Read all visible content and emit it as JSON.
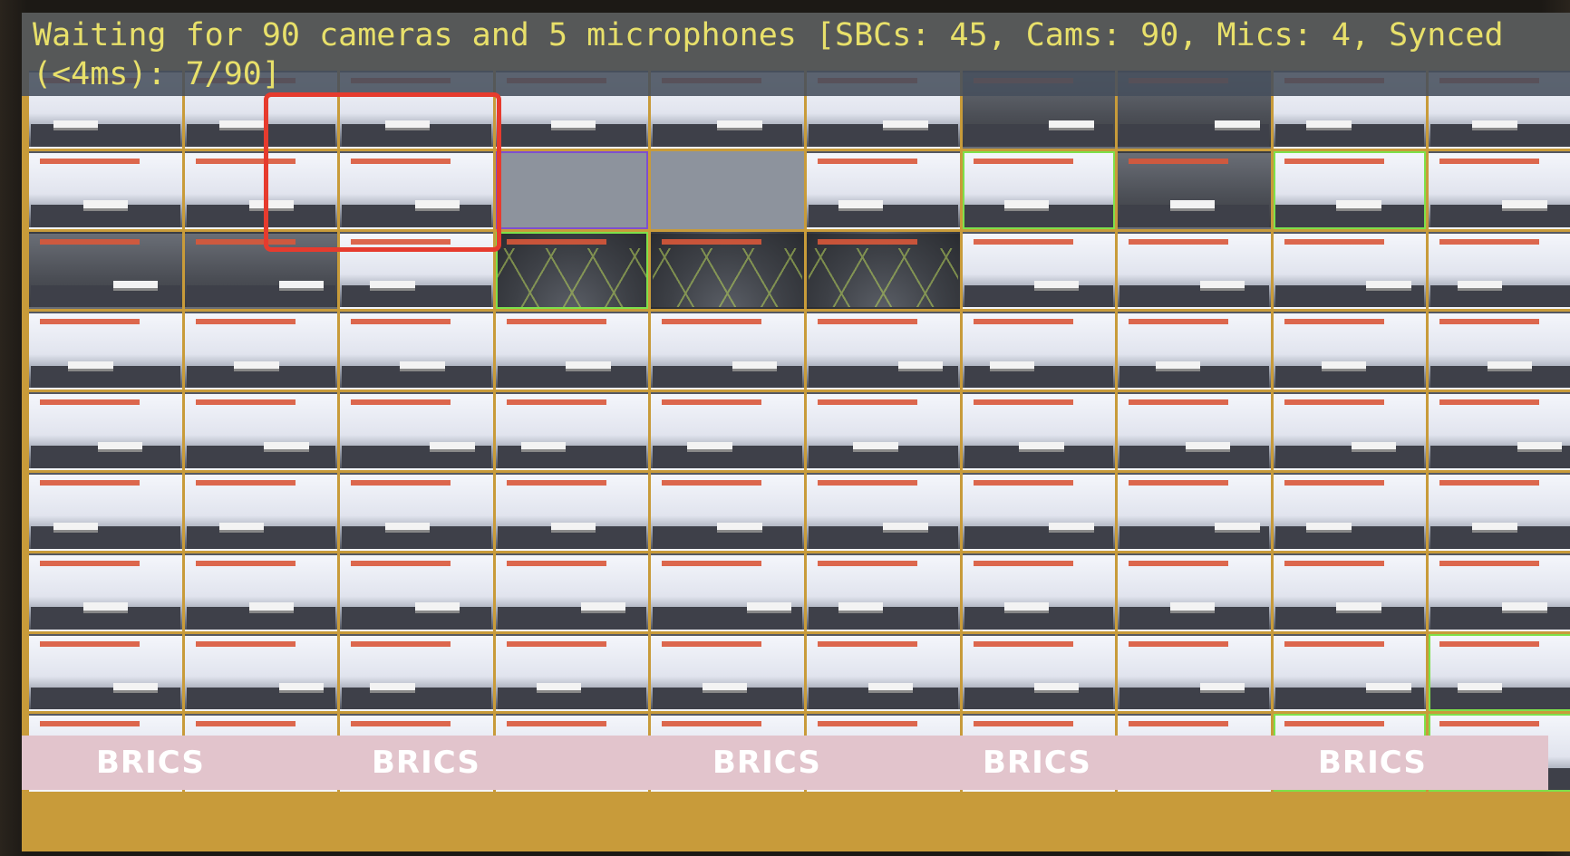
{
  "status": {
    "message": "Waiting for 90 cameras and 5 microphones [SBCs: 45, Cams: 90, Mics: 4, Synced (<4ms): 7/90]"
  },
  "grid": {
    "columns": 10,
    "rows": 9,
    "cells": [
      "alt",
      "alt",
      "alt",
      "alt",
      "alt",
      "alt",
      "dark",
      "dark",
      "alt",
      "alt",
      "alt",
      "alt",
      "alt",
      "blank-purple",
      "blank",
      "alt",
      "alt-green",
      "dark",
      "alt-green",
      "alt",
      "dark",
      "dark",
      "alt",
      "dome-green",
      "dome",
      "dome",
      "alt",
      "alt",
      "alt",
      "alt",
      "alt",
      "alt",
      "alt",
      "alt",
      "alt",
      "alt",
      "alt",
      "alt",
      "alt",
      "alt",
      "alt",
      "alt",
      "alt",
      "alt",
      "alt",
      "alt",
      "alt",
      "alt",
      "alt",
      "alt",
      "alt",
      "alt",
      "alt",
      "alt",
      "alt",
      "alt",
      "alt",
      "alt",
      "alt",
      "alt",
      "alt",
      "alt",
      "alt",
      "alt",
      "alt",
      "alt",
      "alt",
      "alt",
      "alt",
      "alt",
      "alt",
      "alt",
      "alt",
      "alt",
      "alt",
      "alt",
      "alt",
      "alt",
      "alt",
      "alt-green",
      "alt",
      "alt",
      "alt",
      "alt",
      "alt",
      "alt",
      "alt",
      "alt",
      "alt-green",
      "alt-green"
    ]
  },
  "branding": {
    "logo_text": "BRICS",
    "instances": [
      "BRICS",
      "BRICS",
      "BRICS",
      "BRICS",
      "BRICS"
    ]
  },
  "colors": {
    "grid_line": "#c89b3a",
    "status_text": "#e8e06a",
    "highlight": "#e63b2e",
    "synced_border": "#7ee04a"
  }
}
